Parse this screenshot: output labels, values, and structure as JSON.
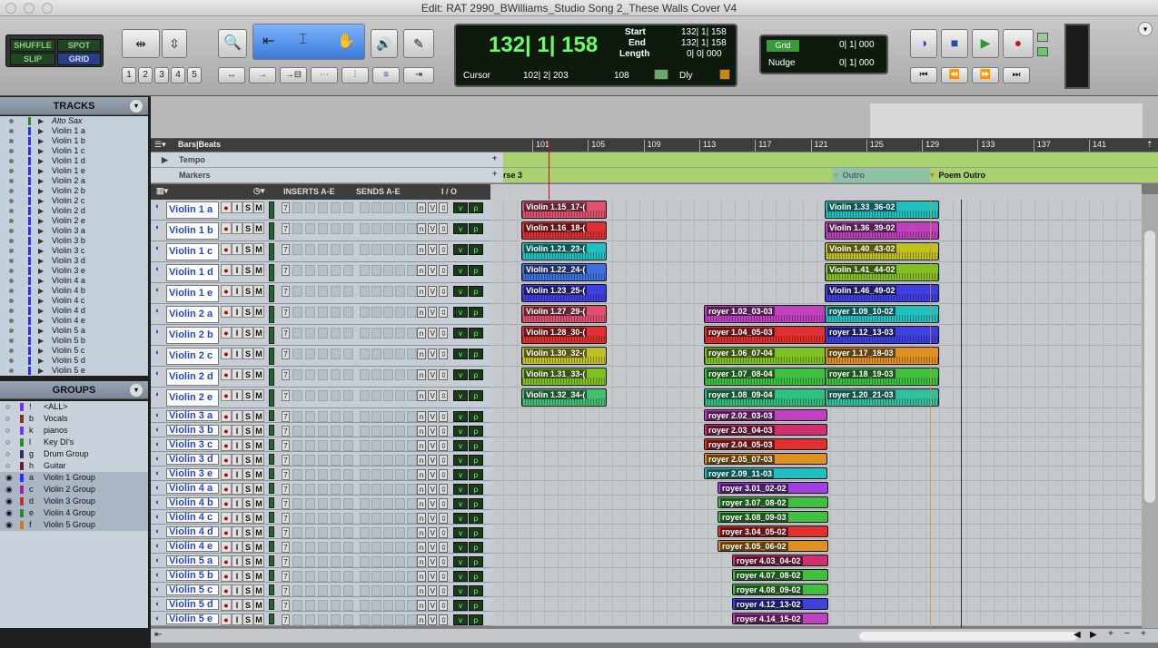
{
  "window": {
    "title": "Edit: RAT 2990_BWilliams_Studio Song 2_These Walls Cover V4"
  },
  "toolbar": {
    "modes": {
      "shuffle": "SHUFFLE",
      "spot": "SPOT",
      "slip": "SLIP",
      "grid": "GRID"
    },
    "zoom_presets": [
      "1",
      "2",
      "3",
      "4",
      "5"
    ],
    "counter": {
      "main": "132| 1| 158",
      "cursor_label": "Cursor",
      "cursor_value": "102| 2| 203",
      "tempo": "108",
      "dly": "Dly",
      "start_label": "Start",
      "start": "132| 1| 158",
      "end_label": "End",
      "end": "132| 1| 158",
      "length_label": "Length",
      "length": "0| 0| 000"
    },
    "grid": {
      "label": "Grid",
      "value": "0| 1| 000",
      "nudge_label": "Nudge",
      "nudge_value": "0| 1| 000"
    }
  },
  "tracks_panel": {
    "title": "TRACKS",
    "items": [
      "Alto Sax",
      "Violin 1 a",
      "Violin 1 b",
      "Violin 1 c",
      "Violin 1 d",
      "Violin 1 e",
      "Violin 2 a",
      "Violin 2 b",
      "Violin 2 c",
      "Violin 2 d",
      "Violin 2 e",
      "Violin 3 a",
      "Violin 3 b",
      "Violin 3 c",
      "Violin 3 d",
      "Violin 3 e",
      "Violin 4 a",
      "Violin 4 b",
      "Violin 4 c",
      "Violin 4 d",
      "Violin 4 e",
      "Violin 5 a",
      "Violin 5 b",
      "Violin 5 c",
      "Violin 5 d",
      "Violin 5 e"
    ]
  },
  "groups_panel": {
    "title": "GROUPS",
    "items": [
      {
        "letter": "!",
        "name": "<ALL>",
        "color": "#7b2cff"
      },
      {
        "letter": "b",
        "name": "Vocals",
        "color": "#7a3a20"
      },
      {
        "letter": "k",
        "name": "pianos",
        "color": "#7b2cff"
      },
      {
        "letter": "l",
        "name": "Key DI's",
        "color": "#2c8a2c"
      },
      {
        "letter": "g",
        "name": "Drum Group",
        "color": "#3a2a5a"
      },
      {
        "letter": "h",
        "name": "Guitar",
        "color": "#6a1a3a"
      },
      {
        "letter": "a",
        "name": "Violin 1 Group",
        "color": "#2c2cff"
      },
      {
        "letter": "c",
        "name": "Violin 2 Group",
        "color": "#a020a0"
      },
      {
        "letter": "d",
        "name": "Violin 3 Group",
        "color": "#c03030"
      },
      {
        "letter": "e",
        "name": "Violin 4 Group",
        "color": "#2c8a2c"
      },
      {
        "letter": "f",
        "name": "Violin 5 Group",
        "color": "#c08020"
      }
    ]
  },
  "rulers": {
    "barsbeats": "Bars|Beats",
    "tempo": "Tempo",
    "markers": "Markers",
    "bars": [
      "101",
      "105",
      "109",
      "113",
      "117",
      "121",
      "125",
      "129",
      "133",
      "137",
      "141"
    ],
    "marker_names": [
      "rse 3",
      "Outro",
      "Poem Outro"
    ]
  },
  "columns": {
    "inserts": "INSERTS A-E",
    "sends": "SENDS A-E",
    "io": "I / O"
  },
  "track_buttons": {
    "rec": "●",
    "input": "I",
    "solo": "S",
    "mute": "M",
    "insert": "7",
    "voice_a": "n",
    "voice_b": "V",
    "v": "v",
    "p": "p"
  },
  "edit_tracks": [
    {
      "name": "Violin 1 a",
      "clips": [
        {
          "name": "Violin 1.15_17-(",
          "color": "#e05070"
        },
        {
          "name": "Violin 1.33_36-02",
          "color": "#20c0c0"
        }
      ]
    },
    {
      "name": "Violin 1 b",
      "clips": [
        {
          "name": "Violin 1.16_18-(",
          "color": "#e03030"
        },
        {
          "name": "Violin 1.36_39-02",
          "color": "#c040c0"
        }
      ]
    },
    {
      "name": "Violin 1 c",
      "clips": [
        {
          "name": "Violin 1.21_23-(",
          "color": "#20c0c0"
        },
        {
          "name": "Violin 1.40_43-02",
          "color": "#c0c020"
        }
      ]
    },
    {
      "name": "Violin 1 d",
      "clips": [
        {
          "name": "Violin 1.22_24-(",
          "color": "#4070e0"
        },
        {
          "name": "Violin 1.41_44-02",
          "color": "#80c020"
        }
      ]
    },
    {
      "name": "Violin 1 e",
      "clips": [
        {
          "name": "Violin 1.23_25-(",
          "color": "#4040e0"
        },
        {
          "name": "Violin 1.46_49-02",
          "color": "#4040e0"
        }
      ]
    },
    {
      "name": "Violin 2 a",
      "clips": [
        {
          "name": "Violin 1.27_29-(",
          "color": "#e05070"
        },
        {
          "name": "royer 1.02_03-03",
          "color": "#c040c0"
        },
        {
          "name": "royer 1.09_10-02",
          "color": "#20c0c0"
        }
      ]
    },
    {
      "name": "Violin 2 b",
      "clips": [
        {
          "name": "Violin 1.28_30-(",
          "color": "#e03030"
        },
        {
          "name": "royer 1.04_05-03",
          "color": "#e03030"
        },
        {
          "name": "royer 1.12_13-03",
          "color": "#4040e0"
        }
      ]
    },
    {
      "name": "Violin 2 c",
      "clips": [
        {
          "name": "Violin 1.30_32-(",
          "color": "#c0c020"
        },
        {
          "name": "royer 1.06_07-04",
          "color": "#80c020"
        },
        {
          "name": "royer 1.17_18-03",
          "color": "#e09020"
        }
      ]
    },
    {
      "name": "Violin 2 d",
      "clips": [
        {
          "name": "Violin 1.31_33-(",
          "color": "#80c020"
        },
        {
          "name": "royer 1.07_08-04",
          "color": "#40c040"
        },
        {
          "name": "royer 1.18_19-03",
          "color": "#40c040"
        }
      ]
    },
    {
      "name": "Violin 2 e",
      "clips": [
        {
          "name": "Violin 1.32_34-(",
          "color": "#40c070"
        },
        {
          "name": "royer 1.08_09-04",
          "color": "#30c080"
        },
        {
          "name": "royer 1.20_21-03",
          "color": "#30c0a0"
        }
      ]
    },
    {
      "name": "Violin 3 a",
      "clips": [
        {
          "name": "royer 2.02_03-03",
          "color": "#c040c0"
        }
      ]
    },
    {
      "name": "Violin 3 b",
      "clips": [
        {
          "name": "royer 2.03_04-03",
          "color": "#d03070"
        }
      ]
    },
    {
      "name": "Violin 3 c",
      "clips": [
        {
          "name": "royer 2.04_05-03",
          "color": "#e03030"
        }
      ]
    },
    {
      "name": "Violin 3 d",
      "clips": [
        {
          "name": "royer 2.05_07-03",
          "color": "#e09020"
        }
      ]
    },
    {
      "name": "Violin 3 e",
      "clips": [
        {
          "name": "royer 2.09_11-03",
          "color": "#20c0c0"
        }
      ]
    },
    {
      "name": "Violin 4 a",
      "clips": [
        {
          "name": "royer 3.01_02-02",
          "color": "#a040e0"
        }
      ]
    },
    {
      "name": "Violin 4 b",
      "clips": [
        {
          "name": "royer 3.07_08-02",
          "color": "#40c040"
        }
      ]
    },
    {
      "name": "Violin 4 c",
      "clips": [
        {
          "name": "royer 3.08_09-03",
          "color": "#40c040"
        }
      ]
    },
    {
      "name": "Violin 4 d",
      "clips": [
        {
          "name": "royer 3.04_05-02",
          "color": "#e03030"
        }
      ]
    },
    {
      "name": "Violin 4 e",
      "clips": [
        {
          "name": "royer 3.05_06-02",
          "color": "#e09020"
        }
      ]
    },
    {
      "name": "Violin 5 a",
      "clips": [
        {
          "name": "royer 4.03_04-02",
          "color": "#d03070"
        }
      ]
    },
    {
      "name": "Violin 5 b",
      "clips": [
        {
          "name": "royer 4.07_08-02",
          "color": "#40c040"
        }
      ]
    },
    {
      "name": "Violin 5 c",
      "clips": [
        {
          "name": "royer 4.08_09-02",
          "color": "#40c040"
        }
      ]
    },
    {
      "name": "Violin 5 d",
      "clips": [
        {
          "name": "royer 4.12_13-02",
          "color": "#4040e0"
        }
      ]
    },
    {
      "name": "Violin 5 e",
      "clips": [
        {
          "name": "royer 4.14_15-02",
          "color": "#c040c0"
        }
      ]
    }
  ]
}
